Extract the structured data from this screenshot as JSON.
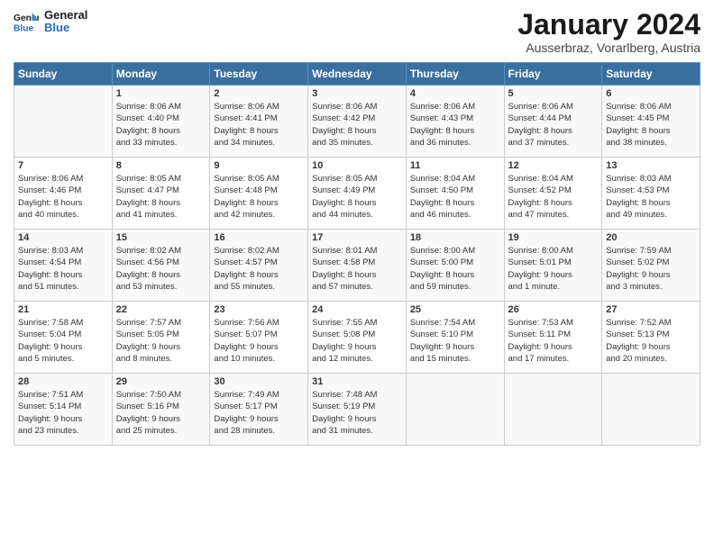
{
  "header": {
    "logo_general": "General",
    "logo_blue": "Blue",
    "month": "January 2024",
    "location": "Ausserbraz, Vorarlberg, Austria"
  },
  "weekdays": [
    "Sunday",
    "Monday",
    "Tuesday",
    "Wednesday",
    "Thursday",
    "Friday",
    "Saturday"
  ],
  "weeks": [
    [
      {
        "day": "",
        "info": ""
      },
      {
        "day": "1",
        "info": "Sunrise: 8:06 AM\nSunset: 4:40 PM\nDaylight: 8 hours\nand 33 minutes."
      },
      {
        "day": "2",
        "info": "Sunrise: 8:06 AM\nSunset: 4:41 PM\nDaylight: 8 hours\nand 34 minutes."
      },
      {
        "day": "3",
        "info": "Sunrise: 8:06 AM\nSunset: 4:42 PM\nDaylight: 8 hours\nand 35 minutes."
      },
      {
        "day": "4",
        "info": "Sunrise: 8:06 AM\nSunset: 4:43 PM\nDaylight: 8 hours\nand 36 minutes."
      },
      {
        "day": "5",
        "info": "Sunrise: 8:06 AM\nSunset: 4:44 PM\nDaylight: 8 hours\nand 37 minutes."
      },
      {
        "day": "6",
        "info": "Sunrise: 8:06 AM\nSunset: 4:45 PM\nDaylight: 8 hours\nand 38 minutes."
      }
    ],
    [
      {
        "day": "7",
        "info": "Sunrise: 8:06 AM\nSunset: 4:46 PM\nDaylight: 8 hours\nand 40 minutes."
      },
      {
        "day": "8",
        "info": "Sunrise: 8:05 AM\nSunset: 4:47 PM\nDaylight: 8 hours\nand 41 minutes."
      },
      {
        "day": "9",
        "info": "Sunrise: 8:05 AM\nSunset: 4:48 PM\nDaylight: 8 hours\nand 42 minutes."
      },
      {
        "day": "10",
        "info": "Sunrise: 8:05 AM\nSunset: 4:49 PM\nDaylight: 8 hours\nand 44 minutes."
      },
      {
        "day": "11",
        "info": "Sunrise: 8:04 AM\nSunset: 4:50 PM\nDaylight: 8 hours\nand 46 minutes."
      },
      {
        "day": "12",
        "info": "Sunrise: 8:04 AM\nSunset: 4:52 PM\nDaylight: 8 hours\nand 47 minutes."
      },
      {
        "day": "13",
        "info": "Sunrise: 8:03 AM\nSunset: 4:53 PM\nDaylight: 8 hours\nand 49 minutes."
      }
    ],
    [
      {
        "day": "14",
        "info": "Sunrise: 8:03 AM\nSunset: 4:54 PM\nDaylight: 8 hours\nand 51 minutes."
      },
      {
        "day": "15",
        "info": "Sunrise: 8:02 AM\nSunset: 4:56 PM\nDaylight: 8 hours\nand 53 minutes."
      },
      {
        "day": "16",
        "info": "Sunrise: 8:02 AM\nSunset: 4:57 PM\nDaylight: 8 hours\nand 55 minutes."
      },
      {
        "day": "17",
        "info": "Sunrise: 8:01 AM\nSunset: 4:58 PM\nDaylight: 8 hours\nand 57 minutes."
      },
      {
        "day": "18",
        "info": "Sunrise: 8:00 AM\nSunset: 5:00 PM\nDaylight: 8 hours\nand 59 minutes."
      },
      {
        "day": "19",
        "info": "Sunrise: 8:00 AM\nSunset: 5:01 PM\nDaylight: 9 hours\nand 1 minute."
      },
      {
        "day": "20",
        "info": "Sunrise: 7:59 AM\nSunset: 5:02 PM\nDaylight: 9 hours\nand 3 minutes."
      }
    ],
    [
      {
        "day": "21",
        "info": "Sunrise: 7:58 AM\nSunset: 5:04 PM\nDaylight: 9 hours\nand 5 minutes."
      },
      {
        "day": "22",
        "info": "Sunrise: 7:57 AM\nSunset: 5:05 PM\nDaylight: 9 hours\nand 8 minutes."
      },
      {
        "day": "23",
        "info": "Sunrise: 7:56 AM\nSunset: 5:07 PM\nDaylight: 9 hours\nand 10 minutes."
      },
      {
        "day": "24",
        "info": "Sunrise: 7:55 AM\nSunset: 5:08 PM\nDaylight: 9 hours\nand 12 minutes."
      },
      {
        "day": "25",
        "info": "Sunrise: 7:54 AM\nSunset: 5:10 PM\nDaylight: 9 hours\nand 15 minutes."
      },
      {
        "day": "26",
        "info": "Sunrise: 7:53 AM\nSunset: 5:11 PM\nDaylight: 9 hours\nand 17 minutes."
      },
      {
        "day": "27",
        "info": "Sunrise: 7:52 AM\nSunset: 5:13 PM\nDaylight: 9 hours\nand 20 minutes."
      }
    ],
    [
      {
        "day": "28",
        "info": "Sunrise: 7:51 AM\nSunset: 5:14 PM\nDaylight: 9 hours\nand 23 minutes."
      },
      {
        "day": "29",
        "info": "Sunrise: 7:50 AM\nSunset: 5:16 PM\nDaylight: 9 hours\nand 25 minutes."
      },
      {
        "day": "30",
        "info": "Sunrise: 7:49 AM\nSunset: 5:17 PM\nDaylight: 9 hours\nand 28 minutes."
      },
      {
        "day": "31",
        "info": "Sunrise: 7:48 AM\nSunset: 5:19 PM\nDaylight: 9 hours\nand 31 minutes."
      },
      {
        "day": "",
        "info": ""
      },
      {
        "day": "",
        "info": ""
      },
      {
        "day": "",
        "info": ""
      }
    ]
  ]
}
